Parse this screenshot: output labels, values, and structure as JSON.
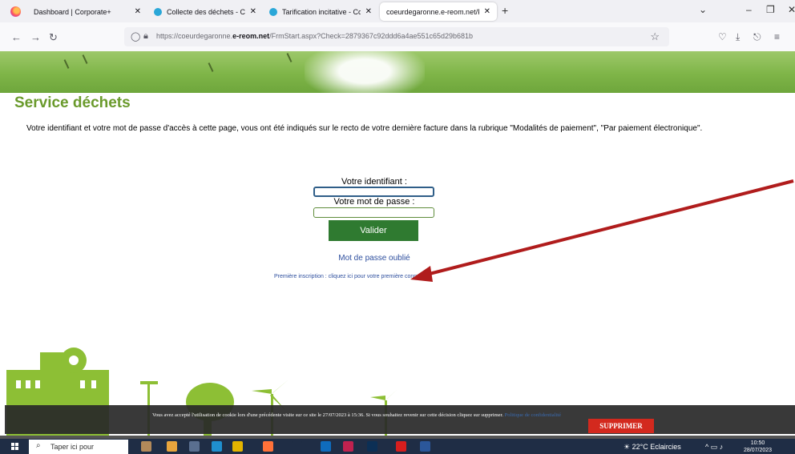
{
  "browser": {
    "tabs": [
      {
        "title": "Dashboard | Corporate+",
        "favicon_color": "#3b5998"
      },
      {
        "title": "Collecte des déchets - Cœur de",
        "favicon_color": "#2aa7d8"
      },
      {
        "title": "Tarification incitative - Cœur de",
        "favicon_color": "#2aa7d8"
      },
      {
        "title": "coeurdegaronne.e-reom.net/FrmSta",
        "favicon_color": "#cccccc"
      }
    ],
    "url": {
      "prefix": "https://coeurdegaronne.",
      "domain": "e-reom.net",
      "path": "/FrmStart.aspx?Check=2879367c92ddd6a4ae551c65d29b681b"
    }
  },
  "page": {
    "title": "Service déchets",
    "intro": "Votre identifiant et votre mot de passe d'accès à cette page, vous ont été indiqués sur le recto de votre dernière facture dans la rubrique \"Modalités de paiement\", \"Par paiement électronique\".",
    "login": {
      "id_label": "Votre identifiant :",
      "pw_label": "Votre mot de passe :",
      "id_value": "",
      "pw_value": "",
      "submit_label": "Valider",
      "forgot_label": "Mot de passe oublié",
      "first_signup_label": "Première inscription : cliquez ici pour votre première connexion"
    },
    "cookie": {
      "text": "Vous avez accepté l'utilisation de cookie lors d'une précédente visite sur ce site le 27/07/2023 à 15:36. Si vous souhaitez revenir sur cette décision cliquez sur supprimer.",
      "policy_link": "Politique de confidentialité",
      "button_label": "SUPPRIMER"
    }
  },
  "annotation": {
    "arrow_color": "#b01c1c"
  },
  "taskbar": {
    "search_placeholder": "Taper ici pour",
    "weather": "22°C Eclaircies",
    "time": "10:50",
    "date": "28/07/2023"
  },
  "colors": {
    "title_green": "#6a9a2c",
    "button_green": "#2f7a30",
    "link_blue": "#2e4f9e",
    "delete_red": "#d3291e"
  }
}
